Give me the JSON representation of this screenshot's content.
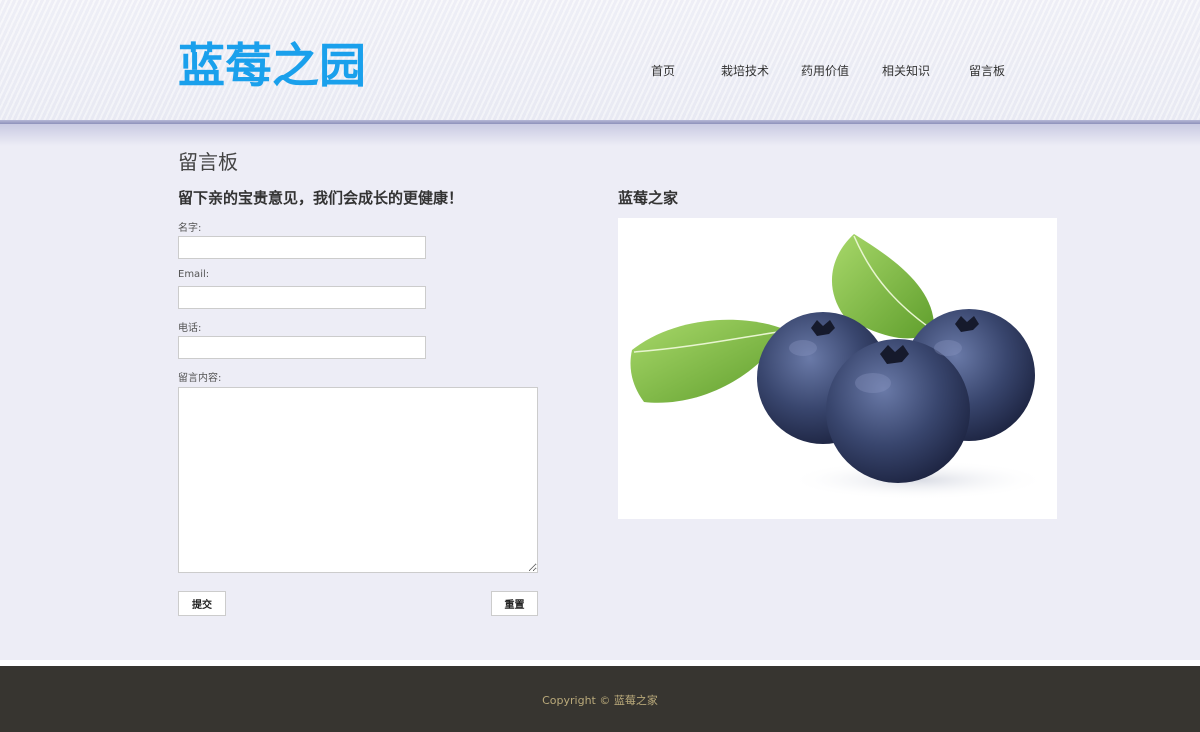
{
  "site": {
    "logo": "蓝莓之园"
  },
  "nav": {
    "items": [
      {
        "label": "首页"
      },
      {
        "label": "栽培技术"
      },
      {
        "label": "药用价值"
      },
      {
        "label": "相关知识"
      },
      {
        "label": "留言板"
      }
    ]
  },
  "main": {
    "title": "留言板",
    "subtitle": "留下亲的宝贵意见，我们会成长的更健康！",
    "form": {
      "name_label": "名字:",
      "name_value": "",
      "email_label": "Email:",
      "email_value": "",
      "phone_label": "电话:",
      "phone_value": "",
      "message_label": "留言内容:",
      "message_value": "",
      "submit_label": "提交",
      "reset_label": "重置"
    }
  },
  "side": {
    "title": "蓝莓之家",
    "image": "blueberries-with-leaves"
  },
  "footer": {
    "copyright": "Copyright © 蓝莓之家"
  },
  "colors": {
    "logo": "#1aa0ec",
    "page_bg": "#ededf6",
    "footer_bg": "#373530",
    "footer_text": "#b9a97a"
  }
}
